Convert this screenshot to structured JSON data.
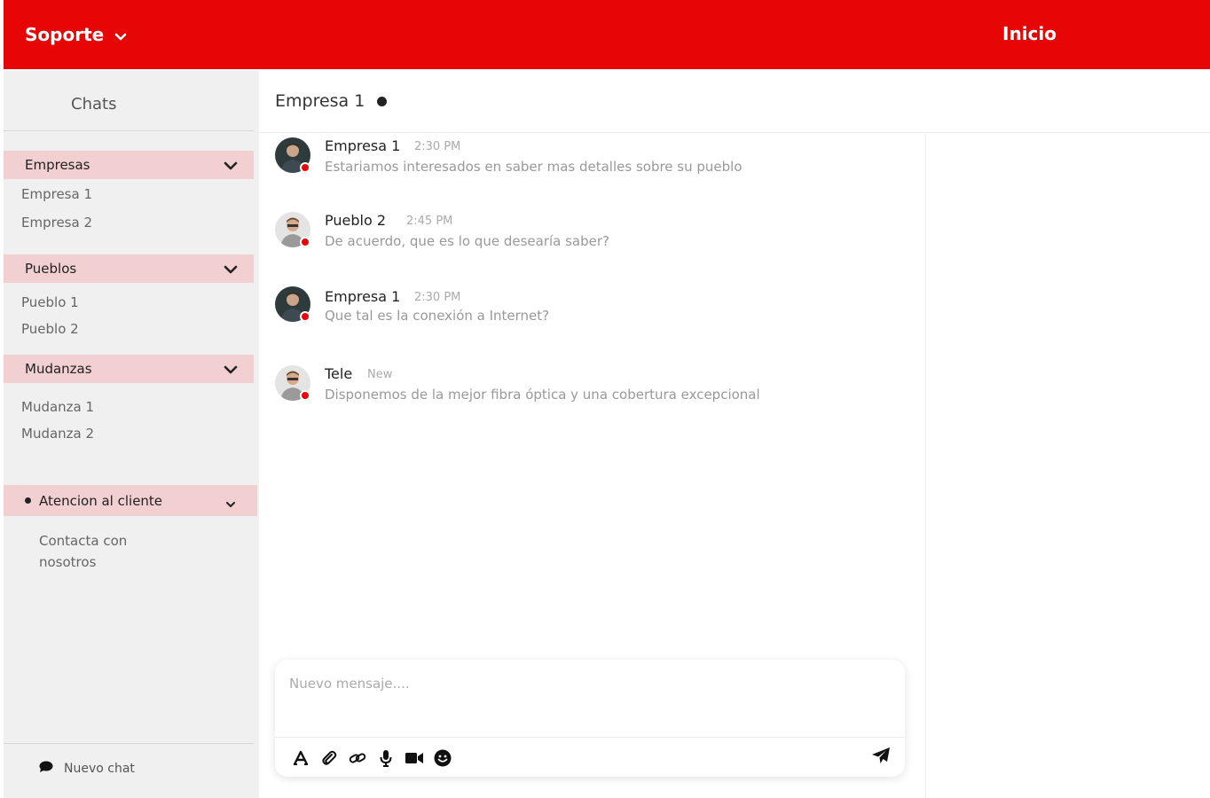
{
  "header": {
    "brand_label": "Soporte",
    "home_label": "Inicio",
    "bg_color": "#e60606"
  },
  "sidebar": {
    "title": "Chats",
    "groups": [
      {
        "label": "Empresas",
        "items": [
          "Empresa 1",
          "Empresa 2"
        ]
      },
      {
        "label": "Pueblos",
        "items": [
          "Pueblo 1",
          "Pueblo 2"
        ]
      },
      {
        "label": "Mudanzas",
        "items": [
          "Mudanza 1",
          "Mudanza 2"
        ]
      }
    ],
    "support": {
      "label": "Atencion al cliente",
      "contact_label": "Contacta con nosotros"
    },
    "new_chat_label": "Nuevo chat"
  },
  "chat": {
    "title": "Empresa 1",
    "messages": [
      {
        "author": "Empresa 1",
        "time": "2:30 PM",
        "text": "Estariamos interesados en saber mas detalles sobre su pueblo",
        "avatar": "dark"
      },
      {
        "author": "Pueblo 2",
        "time": "2:45 PM",
        "text": "De acuerdo, que es lo que desearía saber?",
        "avatar": "light"
      },
      {
        "author": "Empresa 1",
        "time": "2:30 PM",
        "text": "Que tal es la conexión a Internet?",
        "avatar": "dark"
      },
      {
        "author": "Tele",
        "time": "New",
        "text": "Disponemos de la mejor fibra óptica y una cobertura excepcional",
        "avatar": "light"
      }
    ],
    "composer": {
      "placeholder": "Nuevo mensaje....",
      "tools": [
        "text-format-icon",
        "paperclip-icon",
        "link-icon",
        "microphone-icon",
        "video-camera-icon",
        "emoji-icon"
      ],
      "send_icon": "send-icon"
    }
  },
  "colors": {
    "accent": "#e60606",
    "group_bg": "#f2cfd0",
    "sidebar_bg": "#f0f0f0"
  }
}
